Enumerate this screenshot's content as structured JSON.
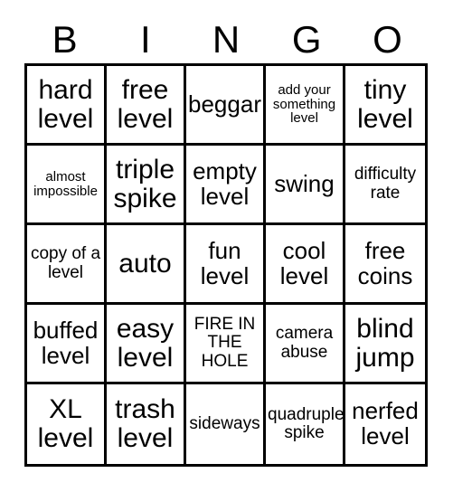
{
  "card": {
    "header": {
      "letters": [
        "B",
        "I",
        "N",
        "G",
        "O"
      ]
    },
    "columns": 5,
    "rows": 5,
    "colors": {
      "background": "#ffffff",
      "grid_line": "#000000",
      "text": "#000000"
    },
    "cells": [
      {
        "text": "hard level",
        "size": "lg",
        "row": 1,
        "col": 1,
        "column_letter": "B",
        "marked": false
      },
      {
        "text": "free level",
        "size": "lg",
        "row": 1,
        "col": 2,
        "column_letter": "I",
        "marked": false
      },
      {
        "text": "beggar",
        "size": "md",
        "row": 1,
        "col": 3,
        "column_letter": "N",
        "marked": false
      },
      {
        "text": "add your something level",
        "size": "xs",
        "row": 1,
        "col": 4,
        "column_letter": "G",
        "marked": false
      },
      {
        "text": "tiny level",
        "size": "lg",
        "row": 1,
        "col": 5,
        "column_letter": "O",
        "marked": false
      },
      {
        "text": "almost impossible",
        "size": "xs",
        "row": 2,
        "col": 1,
        "column_letter": "B",
        "marked": false
      },
      {
        "text": "triple spike",
        "size": "lg",
        "row": 2,
        "col": 2,
        "column_letter": "I",
        "marked": false
      },
      {
        "text": "empty level",
        "size": "md",
        "row": 2,
        "col": 3,
        "column_letter": "N",
        "marked": false
      },
      {
        "text": "swing",
        "size": "md",
        "row": 2,
        "col": 4,
        "column_letter": "G",
        "marked": false
      },
      {
        "text": "difficulty rate",
        "size": "sm",
        "row": 2,
        "col": 5,
        "column_letter": "O",
        "marked": false
      },
      {
        "text": "copy of a level",
        "size": "sm",
        "row": 3,
        "col": 1,
        "column_letter": "B",
        "marked": false
      },
      {
        "text": "auto",
        "size": "lg",
        "row": 3,
        "col": 2,
        "column_letter": "I",
        "marked": false
      },
      {
        "text": "fun level",
        "size": "md",
        "row": 3,
        "col": 3,
        "column_letter": "N",
        "marked": false
      },
      {
        "text": "cool level",
        "size": "md",
        "row": 3,
        "col": 4,
        "column_letter": "G",
        "marked": false
      },
      {
        "text": "free coins",
        "size": "md",
        "row": 3,
        "col": 5,
        "column_letter": "O",
        "marked": false
      },
      {
        "text": "buffed level",
        "size": "md",
        "row": 4,
        "col": 1,
        "column_letter": "B",
        "marked": false
      },
      {
        "text": "easy level",
        "size": "lg",
        "row": 4,
        "col": 2,
        "column_letter": "I",
        "marked": false
      },
      {
        "text": "FIRE IN THE HOLE",
        "size": "sm",
        "row": 4,
        "col": 3,
        "column_letter": "N",
        "marked": false
      },
      {
        "text": "camera abuse",
        "size": "sm",
        "row": 4,
        "col": 4,
        "column_letter": "G",
        "marked": false
      },
      {
        "text": "blind jump",
        "size": "lg",
        "row": 4,
        "col": 5,
        "column_letter": "O",
        "marked": false
      },
      {
        "text": "XL level",
        "size": "lg",
        "row": 5,
        "col": 1,
        "column_letter": "B",
        "marked": false
      },
      {
        "text": "trash level",
        "size": "lg",
        "row": 5,
        "col": 2,
        "column_letter": "I",
        "marked": false
      },
      {
        "text": "sideways",
        "size": "sm",
        "row": 5,
        "col": 3,
        "column_letter": "N",
        "marked": false
      },
      {
        "text": "quadruple spike",
        "size": "sm",
        "row": 5,
        "col": 4,
        "column_letter": "G",
        "marked": false
      },
      {
        "text": "nerfed level",
        "size": "md",
        "row": 5,
        "col": 5,
        "column_letter": "O",
        "marked": false
      }
    ]
  }
}
